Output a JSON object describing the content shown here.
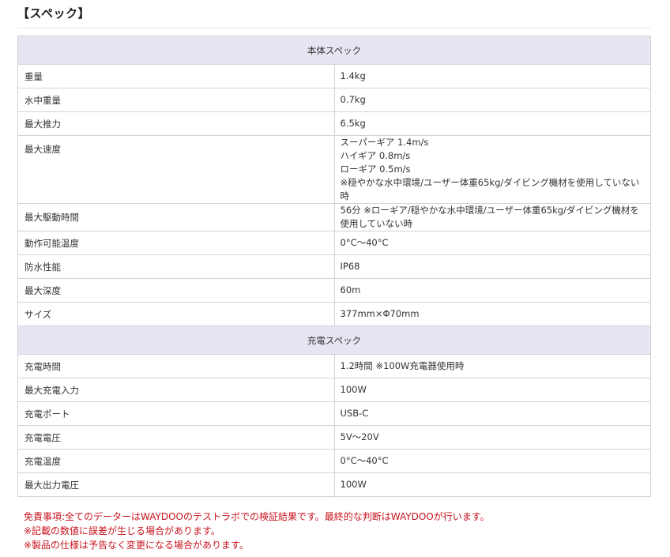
{
  "heading": "【スペック】",
  "sections": {
    "body": {
      "title": "本体スペック",
      "rows": [
        {
          "label": "重量",
          "value": "1.4kg"
        },
        {
          "label": "水中重量",
          "value": "0.7kg"
        },
        {
          "label": "最大推力",
          "value": "6.5kg"
        },
        {
          "label": "最大速度",
          "lines": [
            "スーパーギア 1.4m/s",
            "ハイギア 0.8m/s",
            "ローギア 0.5m/s",
            "※穏やかな水中環境/ユーザー体重65kg/ダイビング機材を使用していない時"
          ]
        },
        {
          "label": "最大駆動時間",
          "value": "56分 ※ローギア/穏やかな水中環境/ユーザー体重65kg/ダイビング機材を使用していない時"
        },
        {
          "label": "動作可能温度",
          "value": "0°C〜40°C"
        },
        {
          "label": "防水性能",
          "value": "IP68"
        },
        {
          "label": "最大深度",
          "value": "60m"
        },
        {
          "label": "サイズ",
          "value": "377mm×Φ70mm"
        }
      ]
    },
    "charge": {
      "title": "充電スペック",
      "rows": [
        {
          "label": "充電時間",
          "value": "1.2時間 ※100W充電器使用時"
        },
        {
          "label": "最大充電入力",
          "value": "100W"
        },
        {
          "label": "充電ポート",
          "value": "USB-C"
        },
        {
          "label": "充電電圧",
          "value": "5V〜20V"
        },
        {
          "label": "充電温度",
          "value": "0°C〜40°C"
        },
        {
          "label": "最大出力電圧",
          "value": "100W"
        }
      ]
    }
  },
  "notes": [
    "免責事項:全てのデーターはWAYDOOのテストラボでの検証結果です。最終的な判断はWAYDOOが行います。",
    "※記載の数値に誤差が生じる場合があります。",
    "※製品の仕様は予告なく変更になる場合があります。"
  ],
  "colors": {
    "section_header_bg": "#e6e6f2",
    "border": "#d3d3d8",
    "note_text": "#c8141e"
  }
}
